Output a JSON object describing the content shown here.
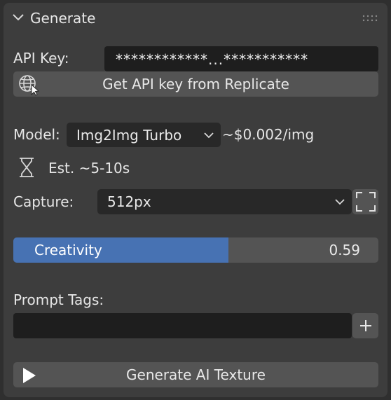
{
  "panel": {
    "title": "Generate"
  },
  "api": {
    "label": "API Key:",
    "masked_value": "************...***********",
    "get_key_button": "Get API key from Replicate"
  },
  "model": {
    "label": "Model:",
    "selected": "Img2Img Turbo",
    "price": "~$0.002/img"
  },
  "estimate": {
    "text": "Est. ~5-10s"
  },
  "capture": {
    "label": "Capture:",
    "selected": "512px"
  },
  "creativity": {
    "label": "Creativity",
    "value_text": "0.59",
    "value": 0.59
  },
  "prompt_tags": {
    "label": "Prompt Tags:",
    "value": ""
  },
  "generate": {
    "button": "Generate AI Texture"
  },
  "colors": {
    "accent": "#4772b3",
    "panel_bg": "#3d3d3d",
    "field_bg": "#1e1e1e",
    "button_bg": "#545454"
  }
}
